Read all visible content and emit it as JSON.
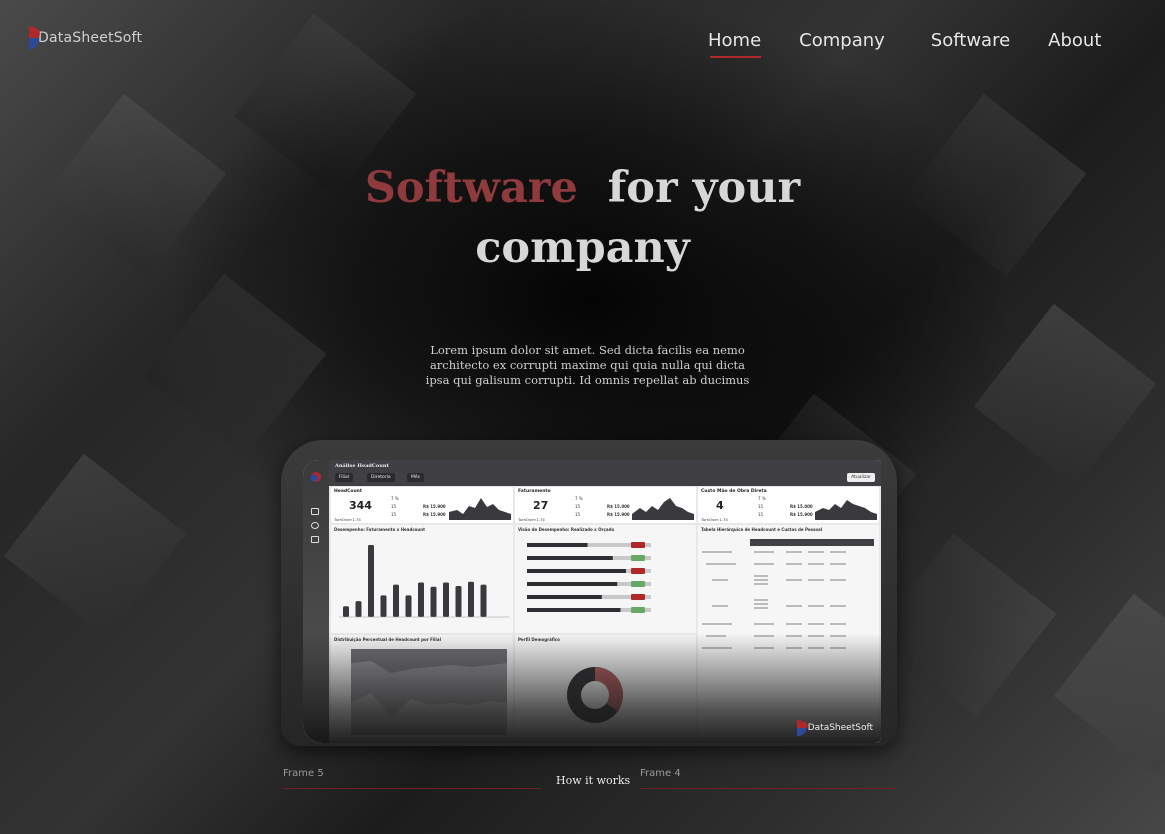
{
  "brand": {
    "logo_text": "DataSheetSoft",
    "accent_color": "#b0282a",
    "logo_blue": "#2b4a9a"
  },
  "nav": {
    "items": [
      {
        "label": "Home",
        "active": true
      },
      {
        "label": "Company"
      },
      {
        "label": "Software"
      },
      {
        "label": "About"
      }
    ]
  },
  "hero": {
    "title_accent": "Software",
    "title_rest_1": "for your",
    "title_rest_2": "company",
    "description": [
      "Lorem ipsum dolor sit amet. Sed dicta facilis ea nemo",
      "architecto ex corrupti maxime qui quia nulla qui dicta",
      "ipsa qui galisum corrupti. Id omnis repellat ab ducimus"
    ]
  },
  "dashboard": {
    "title": "Análise HeadCount",
    "filters": [
      "Filial",
      "Diretoria",
      "Mês"
    ],
    "update_label": "Atualizar",
    "kpis": [
      {
        "title": "HeadCount",
        "value": "344",
        "pct": "7 %",
        "count_a": "15",
        "count_b": "15",
        "money_a": "R$ 15.900",
        "money_b": "R$ 15.900",
        "sub": "TurnOver:1.74"
      },
      {
        "title": "Faturamento",
        "value": "27",
        "pct": "7 %",
        "count_a": "15",
        "count_b": "15",
        "money_a": "R$ 15.000",
        "money_b": "R$ 15.900",
        "sub": "TurnOver:1.74"
      },
      {
        "title": "Custo Mão de Obra Direta",
        "value": "4",
        "pct": "7 %",
        "count_a": "15",
        "count_b": "15",
        "money_a": "R$ 15.000",
        "money_b": "R$ 15.900",
        "sub": "TurnOver:1.74"
      }
    ],
    "panels": {
      "perf": "Desempenho: Faturamento x Headcount",
      "hbar": "Visão de Desempenho: Realizado x Orçado",
      "table": "Tabela Hierárquica de Headcount e Custos de Pessoal",
      "area": "Distribuição Percentual de Headcount por Filial",
      "donut": "Perfil Demográfico"
    },
    "watermark": "DataSheetSoft",
    "bars": [
      0.15,
      0.22,
      1.0,
      0.3,
      0.45,
      0.3,
      0.48,
      0.42,
      0.48,
      0.43,
      0.49,
      0.45
    ],
    "hbars": [
      0.55,
      0.78,
      0.9,
      0.82,
      0.68,
      0.85
    ],
    "donut_pct": 0.35
  },
  "bottom": {
    "left_frame": "Frame 5",
    "center": "How it works",
    "right_frame": "Frame 4"
  }
}
